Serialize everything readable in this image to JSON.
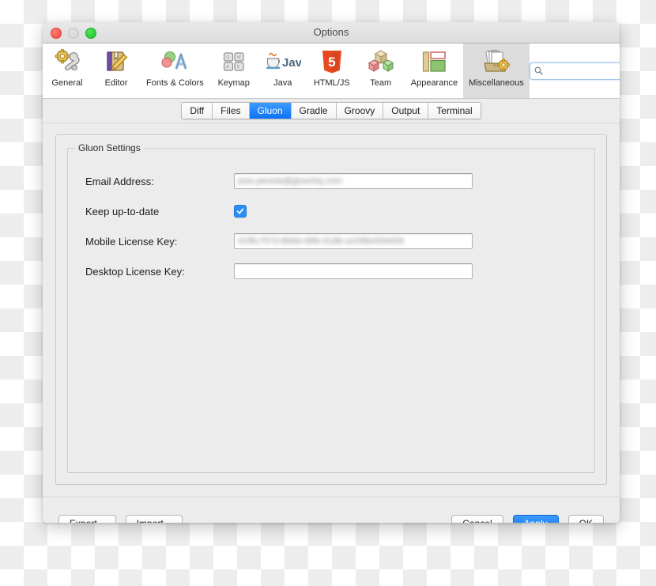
{
  "window": {
    "title": "Options",
    "traffic_lights": [
      "close-button",
      "minimize-button",
      "zoom-button"
    ]
  },
  "toolbar": {
    "items": [
      {
        "label": "General",
        "icon": "gear-wrench-icon",
        "selected": false
      },
      {
        "label": "Editor",
        "icon": "book-pencil-icon",
        "selected": false
      },
      {
        "label": "Fonts & Colors",
        "icon": "font-colors-icon",
        "selected": false
      },
      {
        "label": "Keymap",
        "icon": "keyboard-keys-icon",
        "selected": false
      },
      {
        "label": "Java",
        "icon": "java-coffee-icon",
        "selected": false
      },
      {
        "label": "HTML/JS",
        "icon": "html5-shield-icon",
        "selected": false
      },
      {
        "label": "Team",
        "icon": "cubes-icon",
        "selected": false
      },
      {
        "label": "Appearance",
        "icon": "layout-panels-icon",
        "selected": false
      },
      {
        "label": "Miscellaneous",
        "icon": "papers-gear-icon",
        "selected": true
      }
    ],
    "search": {
      "value": "",
      "placeholder": "",
      "icon": "search-icon"
    }
  },
  "tabs": [
    {
      "label": "Diff",
      "active": false
    },
    {
      "label": "Files",
      "active": false
    },
    {
      "label": "Gluon",
      "active": true
    },
    {
      "label": "Gradle",
      "active": false
    },
    {
      "label": "Groovy",
      "active": false
    },
    {
      "label": "Output",
      "active": false
    },
    {
      "label": "Terminal",
      "active": false
    }
  ],
  "settings": {
    "group_title": "Gluon Settings",
    "fields": [
      {
        "label": "Email Address:",
        "type": "text",
        "value": "jose.pereda@gluonhq.com",
        "redacted": true
      },
      {
        "label": "Keep up-to-date",
        "type": "checkbox",
        "checked": true
      },
      {
        "label": "Mobile License Key:",
        "type": "text",
        "value": "91f8c757d-8b8d-49fe-818b-a159be594408",
        "redacted": true
      },
      {
        "label": "Desktop License Key:",
        "type": "text",
        "value": "",
        "redacted": false
      }
    ]
  },
  "footer": {
    "export_label": "Export...",
    "import_label": "Import...",
    "cancel_label": "Cancel",
    "apply_label": "Apply",
    "ok_label": "OK"
  },
  "colors": {
    "accent": "#0a72f5",
    "window_bg": "#ececec",
    "toolbar_bg": "#ffffff",
    "selected_tool_bg": "#dcdcdc"
  }
}
